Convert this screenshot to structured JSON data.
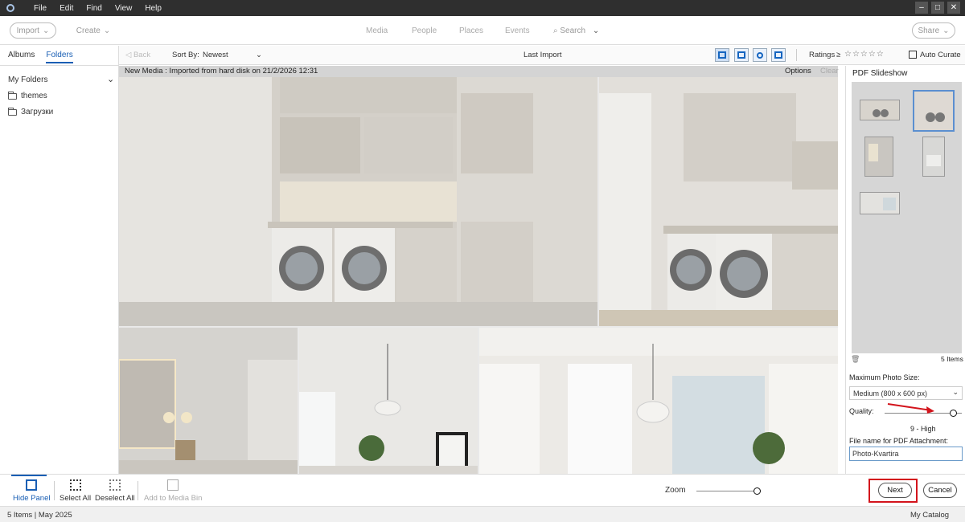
{
  "menubar": {
    "items": [
      "File",
      "Edit",
      "Find",
      "View",
      "Help"
    ]
  },
  "toolbar": {
    "import_label": "Import",
    "create_label": "Create",
    "tabs": [
      "Media",
      "People",
      "Places",
      "Events"
    ],
    "search_label": "Search",
    "share_label": "Share"
  },
  "subbar": {
    "back_label": "Back",
    "sort_label": "Sort By:",
    "sort_value": "Newest",
    "title": "Last Import",
    "ratings_label": "Ratings",
    "ratings_op": "≥",
    "stars": "☆☆☆☆☆",
    "auto_curate_label": "Auto Curate"
  },
  "left_panel": {
    "tab_albums": "Albums",
    "tab_folders": "Folders",
    "my_folders": "My Folders",
    "folders": [
      "themes",
      "Загрузки"
    ]
  },
  "grid": {
    "info": "New Media : Imported from hard disk on 21/2/2026 12:31",
    "options_label": "Options",
    "clear_label": "Clear"
  },
  "right_panel": {
    "title": "PDF Slideshow",
    "items_count": "5 Items",
    "max_size_label": "Maximum Photo Size:",
    "max_size_value": "Medium (800 x 600 px)",
    "quality_label": "Quality:",
    "quality_value_text": "9 - High",
    "quality_level": 0.9,
    "filename_label": "File name for PDF Attachment:",
    "filename_value": "Photo-Kvartira"
  },
  "bottom": {
    "hide_panel": "Hide Panel",
    "select_all": "Select All",
    "deselect_all": "Deselect All",
    "add_to_bin": "Add to Media Bin",
    "zoom_label": "Zoom",
    "zoom_level": 0.95,
    "next_label": "Next",
    "cancel_label": "Cancel"
  },
  "status": {
    "left": "5 Items | May 2025",
    "right": "My Catalog"
  },
  "colors": {
    "accent": "#1a5fb4",
    "highlight_red": "#d3141c"
  }
}
